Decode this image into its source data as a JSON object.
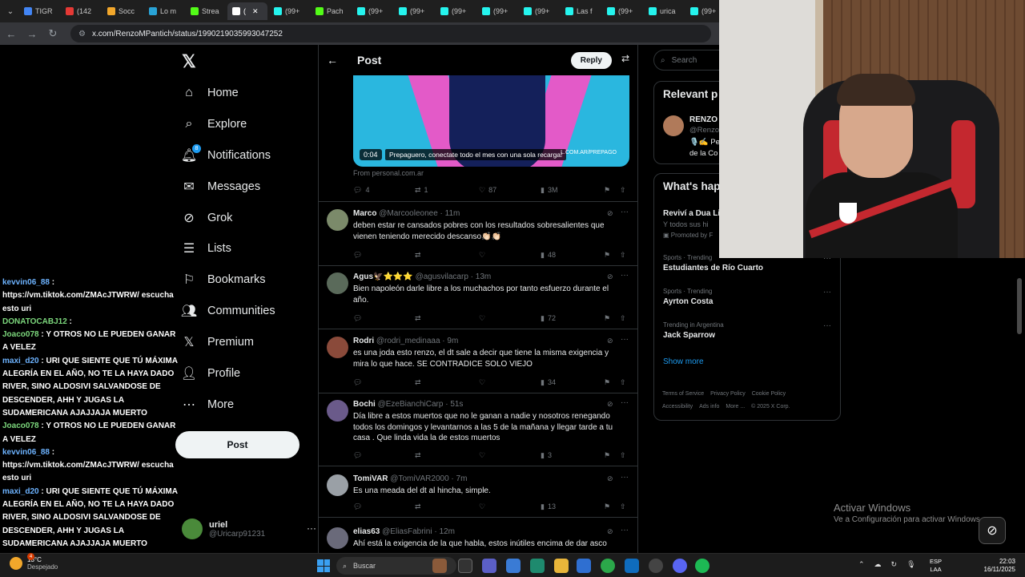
{
  "browser": {
    "tabs": [
      "TIGR",
      "(142",
      "Socc",
      "Lo m",
      "Strea",
      "(",
      "(99+",
      "Pach",
      "(99+",
      "(99+",
      "(99+",
      "(99+",
      "(99+",
      "Las f",
      "(99+",
      "urica",
      "(99+"
    ],
    "url": "x.com/RenzoMPantich/status/1990219035993047252"
  },
  "chat": [
    {
      "user": "kevvin06_88",
      "text": "https://vm.tiktok.com/ZMAcJTWRW/ escucha esto uri"
    },
    {
      "user": "DONATOCABJ12",
      "text": ""
    },
    {
      "user": "Joaco078",
      "text": "Y OTROS NO LE PUEDEN GANAR A VELEZ"
    },
    {
      "user": "maxi_d20",
      "text": "URI QUE SIENTE QUE TÚ MÁXIMA ALEGRÍA EN EL AÑO, NO TE LA HAYA DADO RIVER, SINO ALDOSIVI SALVANDOSE DE DESCENDER, AHH Y JUGAS LA SUDAMERICANA AJAJJAJA MUERTO"
    },
    {
      "user": "Joaco078",
      "text": "Y OTROS NO LE PUEDEN GANAR A VELEZ"
    },
    {
      "user": "kevvin06_88",
      "text": "https://vm.tiktok.com/ZMAcJTWRW/ escucha esto uri"
    },
    {
      "user": "maxi_d20",
      "text": "URI QUE SIENTE QUE TÚ MÁXIMA ALEGRÍA EN EL AÑO, NO TE LA HAYA DADO RIVER, SINO ALDOSIVI SALVANDOSE DE DESCENDER, AHH Y JUGAS LA SUDAMERICANA AJAJJAJA MUERTO"
    }
  ],
  "nav": {
    "items": [
      "Home",
      "Explore",
      "Notifications",
      "Messages",
      "Grok",
      "Lists",
      "Bookmarks",
      "Communities",
      "Premium",
      "Profile",
      "More"
    ],
    "notif_badge": "8",
    "post_label": "Post",
    "account_name": "uriel",
    "account_handle": "@Uricarp91231"
  },
  "main": {
    "title": "Post",
    "reply_label": "Reply",
    "video": {
      "time": "0:04",
      "caption": "Prepaguero, conectate todo el mes con una sola recarga!",
      "brand": "L.COM.AR/PREPAGO",
      "from": "From personal.com.ar"
    },
    "stats": {
      "replies": "4",
      "reposts": "1",
      "likes": "87",
      "views": "3M"
    },
    "replies": [
      {
        "name": "Marco",
        "handle": "@Marcooleonee",
        "time": "11m",
        "text": "deben estar re cansados pobres con los resultados sobresalientes que vienen teniendo merecido descanso👏🏻👏🏻",
        "views": "48",
        "avatar": "#7b8a6a"
      },
      {
        "name": "Agus🦅⭐⭐⭐",
        "handle": "@agusvilacarp",
        "time": "13m",
        "text": "Bien napoleón darle libre a los muchachos por tanto esfuerzo durante el año.",
        "views": "72",
        "avatar": "#5a6a5a"
      },
      {
        "name": "Rodri",
        "handle": "@rodri_medinaaa",
        "time": "9m",
        "text": "es una joda esto renzo, el dt sale a decir que tiene la misma exigencia y mira lo que hace. SE CONTRADICE SOLO VIEJO",
        "views": "34",
        "avatar": "#8a4a3a"
      },
      {
        "name": "Bochi",
        "handle": "@EzeBianchiCarp",
        "time": "51s",
        "text": "Día libre a estos muertos que no le ganan a nadie y nosotros renegando todos los domingos y levantarnos a las 5 de la mañana y llegar tarde a tu casa . Que linda vida la de estos muertos",
        "views": "3",
        "avatar": "#6a5a8a"
      },
      {
        "name": "TomiVAR",
        "handle": "@TomiVAR2000",
        "time": "7m",
        "text": "Es una meada del dt al hincha, simple.",
        "views": "13",
        "avatar": "#9aa0a6"
      },
      {
        "name": "elias63",
        "handle": "@EliasFabrini",
        "time": "12m",
        "text": "Ahí está la exigencia de la que habla, estos inútiles encima de dar asco",
        "views": "",
        "avatar": "#6a6a7a"
      }
    ]
  },
  "right": {
    "search_placeholder": "Search",
    "relevant_title": "Relevant p",
    "relevant_name": "RENZO I",
    "relevant_handle": "@Renzo",
    "relevant_bio1": "🎙️✍️ Pe",
    "relevant_bio2": "de la Co",
    "happening_title": "What's hap",
    "promo_title": "Reviví a Dua Li",
    "promo_sub": "Y todos sus hi",
    "promo_by": "Promoted by F",
    "trends": [
      {
        "category": "Sports · Trending",
        "title": "Estudiantes de Río Cuarto"
      },
      {
        "category": "Sports · Trending",
        "title": "Ayrton Costa"
      },
      {
        "category": "Trending in Argentina",
        "title": "Jack Sparrow"
      }
    ],
    "show_more": "Show more",
    "footer": [
      "Terms of Service",
      "Privacy Policy",
      "Cookie Policy",
      "Accessibility",
      "Ads info",
      "More ...",
      "© 2025 X Corp."
    ]
  },
  "windows": {
    "activate_title": "Activar Windows",
    "activate_sub": "Ve a Configuración para activar Windows.",
    "weather_temp": "13°C",
    "weather_desc": "Despejado",
    "weather_badge": "4",
    "search_label": "Buscar",
    "lang1": "ESP",
    "lang2": "LAA",
    "time": "22:03",
    "date": "16/11/2025"
  }
}
